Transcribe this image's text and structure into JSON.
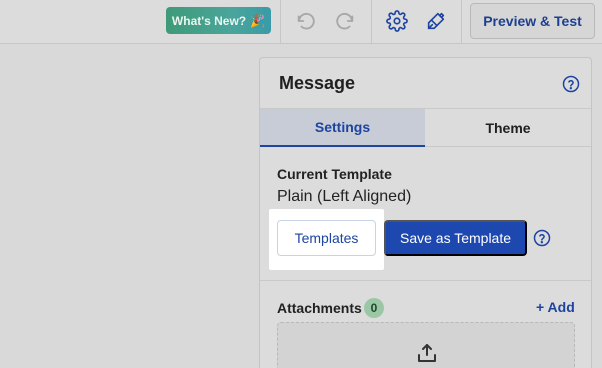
{
  "toolbar": {
    "whats_new_label": "What's New?",
    "whats_new_icon": "party-popper-icon",
    "preview_label": "Preview & Test",
    "icons": [
      "undo-icon",
      "redo-icon",
      "gear-icon",
      "paint-brush-icon"
    ]
  },
  "panel": {
    "title": "Message",
    "tabs": [
      {
        "label": "Settings",
        "active": true
      },
      {
        "label": "Theme",
        "active": false
      }
    ],
    "current_template_label": "Current Template",
    "current_template_value": "Plain (Left Aligned)",
    "templates_button": "Templates",
    "save_template_button": "Save as Template",
    "attachments_label": "Attachments",
    "attachments_count": "0",
    "add_label": "+ Add"
  },
  "colors": {
    "accent": "#1e44a1",
    "primary_button": "#1d48b0",
    "whats_new_bg": "#3e9a78",
    "badge_bg": "#9cc7a6"
  }
}
